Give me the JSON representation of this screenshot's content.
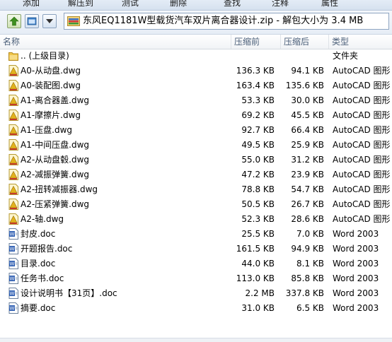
{
  "toolbar": {
    "items": [
      "添加",
      "解压到",
      "测试",
      "删除",
      "查找",
      "注释",
      "属性"
    ]
  },
  "address": {
    "path": "东风EQ1181W型载货汽车双片离合器设计.zip - 解包大小为 3.4 MB"
  },
  "columns": {
    "name": "名称",
    "packed": "压缩前",
    "compressed": "压缩后",
    "type": "类型"
  },
  "files": [
    {
      "name": ".. (上级目录)",
      "before": "",
      "after": "",
      "type": "文件夹",
      "icon": "folder-icon"
    },
    {
      "name": "A0-从动盘.dwg",
      "before": "136.3 KB",
      "after": "94.1 KB",
      "type": "AutoCAD 图形",
      "icon": "dwg-icon"
    },
    {
      "name": "A0-装配图.dwg",
      "before": "163.4 KB",
      "after": "135.6 KB",
      "type": "AutoCAD 图形",
      "icon": "dwg-icon"
    },
    {
      "name": "A1-离合器盖.dwg",
      "before": "53.3 KB",
      "after": "30.0 KB",
      "type": "AutoCAD 图形",
      "icon": "dwg-icon"
    },
    {
      "name": "A1-摩擦片.dwg",
      "before": "69.2 KB",
      "after": "45.5 KB",
      "type": "AutoCAD 图形",
      "icon": "dwg-icon"
    },
    {
      "name": "A1-压盘.dwg",
      "before": "92.7 KB",
      "after": "66.4 KB",
      "type": "AutoCAD 图形",
      "icon": "dwg-icon"
    },
    {
      "name": "A1-中间压盘.dwg",
      "before": "49.5 KB",
      "after": "25.9 KB",
      "type": "AutoCAD 图形",
      "icon": "dwg-icon"
    },
    {
      "name": "A2-从动盘毂.dwg",
      "before": "55.0 KB",
      "after": "31.2 KB",
      "type": "AutoCAD 图形",
      "icon": "dwg-icon"
    },
    {
      "name": "A2-减振弹簧.dwg",
      "before": "47.2 KB",
      "after": "23.9 KB",
      "type": "AutoCAD 图形",
      "icon": "dwg-icon"
    },
    {
      "name": "A2-扭转减振器.dwg",
      "before": "78.8 KB",
      "after": "54.7 KB",
      "type": "AutoCAD 图形",
      "icon": "dwg-icon"
    },
    {
      "name": "A2-压紧弹簧.dwg",
      "before": "50.5 KB",
      "after": "26.7 KB",
      "type": "AutoCAD 图形",
      "icon": "dwg-icon"
    },
    {
      "name": "A2-轴.dwg",
      "before": "52.3 KB",
      "after": "28.6 KB",
      "type": "AutoCAD 图形",
      "icon": "dwg-icon"
    },
    {
      "name": "封皮.doc",
      "before": "25.5 KB",
      "after": "7.0 KB",
      "type": "Word 2003",
      "icon": "word-doc-icon"
    },
    {
      "name": "开题报告.doc",
      "before": "161.5 KB",
      "after": "94.9 KB",
      "type": "Word 2003",
      "icon": "word-doc-icon"
    },
    {
      "name": "目录.doc",
      "before": "44.0 KB",
      "after": "8.1 KB",
      "type": "Word 2003",
      "icon": "word-doc-icon"
    },
    {
      "name": "任务书.doc",
      "before": "113.0 KB",
      "after": "85.8 KB",
      "type": "Word 2003",
      "icon": "word-doc-icon"
    },
    {
      "name": "设计说明书【31页】.doc",
      "before": "2.2 MB",
      "after": "337.8 KB",
      "type": "Word 2003",
      "icon": "word-doc-icon"
    },
    {
      "name": "摘要.doc",
      "before": "31.0 KB",
      "after": "6.5 KB",
      "type": "Word 2003",
      "icon": "word-doc-icon"
    }
  ]
}
